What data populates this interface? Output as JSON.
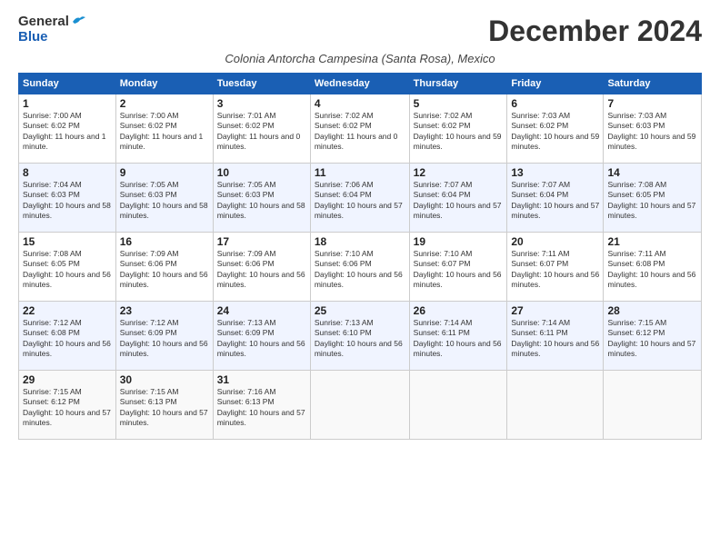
{
  "header": {
    "logo_general": "General",
    "logo_blue": "Blue",
    "month_title": "December 2024",
    "subtitle": "Colonia Antorcha Campesina (Santa Rosa), Mexico"
  },
  "weekdays": [
    "Sunday",
    "Monday",
    "Tuesday",
    "Wednesday",
    "Thursday",
    "Friday",
    "Saturday"
  ],
  "weeks": [
    [
      {
        "day": "1",
        "rise": "7:00 AM",
        "set": "6:02 PM",
        "daylight": "11 hours and 1 minute."
      },
      {
        "day": "2",
        "rise": "7:00 AM",
        "set": "6:02 PM",
        "daylight": "11 hours and 1 minute."
      },
      {
        "day": "3",
        "rise": "7:01 AM",
        "set": "6:02 PM",
        "daylight": "11 hours and 0 minutes."
      },
      {
        "day": "4",
        "rise": "7:02 AM",
        "set": "6:02 PM",
        "daylight": "11 hours and 0 minutes."
      },
      {
        "day": "5",
        "rise": "7:02 AM",
        "set": "6:02 PM",
        "daylight": "10 hours and 59 minutes."
      },
      {
        "day": "6",
        "rise": "7:03 AM",
        "set": "6:02 PM",
        "daylight": "10 hours and 59 minutes."
      },
      {
        "day": "7",
        "rise": "7:03 AM",
        "set": "6:03 PM",
        "daylight": "10 hours and 59 minutes."
      }
    ],
    [
      {
        "day": "8",
        "rise": "7:04 AM",
        "set": "6:03 PM",
        "daylight": "10 hours and 58 minutes."
      },
      {
        "day": "9",
        "rise": "7:05 AM",
        "set": "6:03 PM",
        "daylight": "10 hours and 58 minutes."
      },
      {
        "day": "10",
        "rise": "7:05 AM",
        "set": "6:03 PM",
        "daylight": "10 hours and 58 minutes."
      },
      {
        "day": "11",
        "rise": "7:06 AM",
        "set": "6:04 PM",
        "daylight": "10 hours and 57 minutes."
      },
      {
        "day": "12",
        "rise": "7:07 AM",
        "set": "6:04 PM",
        "daylight": "10 hours and 57 minutes."
      },
      {
        "day": "13",
        "rise": "7:07 AM",
        "set": "6:04 PM",
        "daylight": "10 hours and 57 minutes."
      },
      {
        "day": "14",
        "rise": "7:08 AM",
        "set": "6:05 PM",
        "daylight": "10 hours and 57 minutes."
      }
    ],
    [
      {
        "day": "15",
        "rise": "7:08 AM",
        "set": "6:05 PM",
        "daylight": "10 hours and 56 minutes."
      },
      {
        "day": "16",
        "rise": "7:09 AM",
        "set": "6:06 PM",
        "daylight": "10 hours and 56 minutes."
      },
      {
        "day": "17",
        "rise": "7:09 AM",
        "set": "6:06 PM",
        "daylight": "10 hours and 56 minutes."
      },
      {
        "day": "18",
        "rise": "7:10 AM",
        "set": "6:06 PM",
        "daylight": "10 hours and 56 minutes."
      },
      {
        "day": "19",
        "rise": "7:10 AM",
        "set": "6:07 PM",
        "daylight": "10 hours and 56 minutes."
      },
      {
        "day": "20",
        "rise": "7:11 AM",
        "set": "6:07 PM",
        "daylight": "10 hours and 56 minutes."
      },
      {
        "day": "21",
        "rise": "7:11 AM",
        "set": "6:08 PM",
        "daylight": "10 hours and 56 minutes."
      }
    ],
    [
      {
        "day": "22",
        "rise": "7:12 AM",
        "set": "6:08 PM",
        "daylight": "10 hours and 56 minutes."
      },
      {
        "day": "23",
        "rise": "7:12 AM",
        "set": "6:09 PM",
        "daylight": "10 hours and 56 minutes."
      },
      {
        "day": "24",
        "rise": "7:13 AM",
        "set": "6:09 PM",
        "daylight": "10 hours and 56 minutes."
      },
      {
        "day": "25",
        "rise": "7:13 AM",
        "set": "6:10 PM",
        "daylight": "10 hours and 56 minutes."
      },
      {
        "day": "26",
        "rise": "7:14 AM",
        "set": "6:11 PM",
        "daylight": "10 hours and 56 minutes."
      },
      {
        "day": "27",
        "rise": "7:14 AM",
        "set": "6:11 PM",
        "daylight": "10 hours and 56 minutes."
      },
      {
        "day": "28",
        "rise": "7:15 AM",
        "set": "6:12 PM",
        "daylight": "10 hours and 57 minutes."
      }
    ],
    [
      {
        "day": "29",
        "rise": "7:15 AM",
        "set": "6:12 PM",
        "daylight": "10 hours and 57 minutes."
      },
      {
        "day": "30",
        "rise": "7:15 AM",
        "set": "6:13 PM",
        "daylight": "10 hours and 57 minutes."
      },
      {
        "day": "31",
        "rise": "7:16 AM",
        "set": "6:13 PM",
        "daylight": "10 hours and 57 minutes."
      },
      null,
      null,
      null,
      null
    ]
  ]
}
